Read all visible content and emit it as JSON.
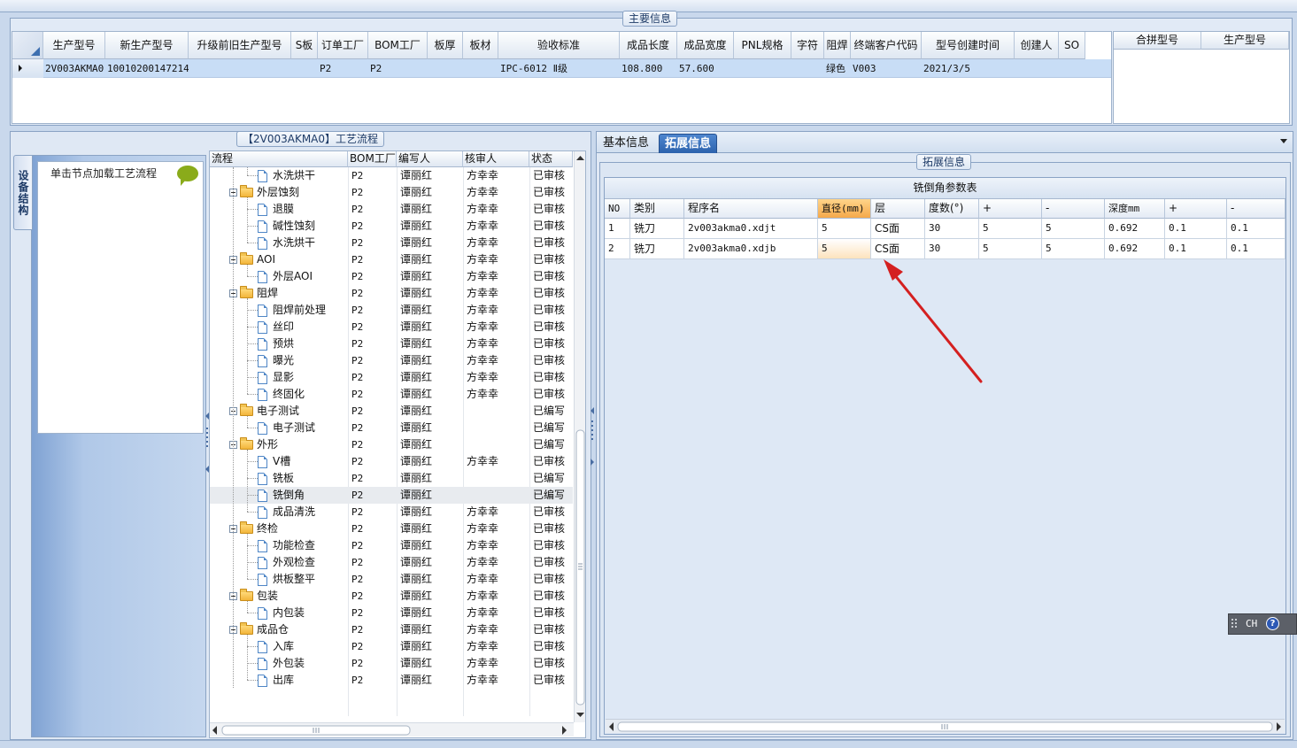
{
  "main_info": {
    "caption": "主要信息",
    "columns": [
      "生产型号",
      "新生产型号",
      "升级前旧生产型号",
      "S板",
      "订单工厂",
      "BOM工厂",
      "板厚",
      "板材",
      "验收标准",
      "成品长度",
      "成品宽度",
      "PNL规格",
      "字符",
      "阻焊",
      "终端客户代码",
      "型号创建时间",
      "创建人",
      "SO"
    ],
    "row": [
      "2V003AKMA0",
      "10010200147214",
      "",
      "",
      "P2",
      "P2",
      "",
      "",
      "IPC-6012 Ⅱ级",
      "108.800",
      "57.600",
      "",
      "",
      "绿色",
      "V003",
      "2021/3/5",
      "",
      ""
    ],
    "merge_columns": [
      "合拼型号",
      "生产型号"
    ]
  },
  "left_panel": {
    "vertical_tab": "设备结构",
    "hint": "单击节点加载工艺流程",
    "process_caption": "【2V003AKMA0】工艺流程",
    "tree_columns": [
      "流程",
      "BOM工厂",
      "编写人",
      "核审人",
      "状态"
    ],
    "rows": [
      {
        "level": 2,
        "name": "水洗烘干",
        "bom": "P2",
        "writer": "谭丽红",
        "reviewer": "方幸幸",
        "status": "已审核"
      },
      {
        "level": 1,
        "name": "外层蚀刻",
        "bom": "P2",
        "writer": "谭丽红",
        "reviewer": "方幸幸",
        "status": "已审核"
      },
      {
        "level": 2,
        "name": "退膜",
        "bom": "P2",
        "writer": "谭丽红",
        "reviewer": "方幸幸",
        "status": "已审核"
      },
      {
        "level": 2,
        "name": "碱性蚀刻",
        "bom": "P2",
        "writer": "谭丽红",
        "reviewer": "方幸幸",
        "status": "已审核"
      },
      {
        "level": 2,
        "name": "水洗烘干",
        "bom": "P2",
        "writer": "谭丽红",
        "reviewer": "方幸幸",
        "status": "已审核"
      },
      {
        "level": 1,
        "name": "AOI",
        "bom": "P2",
        "writer": "谭丽红",
        "reviewer": "方幸幸",
        "status": "已审核"
      },
      {
        "level": 2,
        "name": "外层AOI",
        "bom": "P2",
        "writer": "谭丽红",
        "reviewer": "方幸幸",
        "status": "已审核"
      },
      {
        "level": 1,
        "name": "阻焊",
        "bom": "P2",
        "writer": "谭丽红",
        "reviewer": "方幸幸",
        "status": "已审核"
      },
      {
        "level": 2,
        "name": "阻焊前处理",
        "bom": "P2",
        "writer": "谭丽红",
        "reviewer": "方幸幸",
        "status": "已审核"
      },
      {
        "level": 2,
        "name": "丝印",
        "bom": "P2",
        "writer": "谭丽红",
        "reviewer": "方幸幸",
        "status": "已审核"
      },
      {
        "level": 2,
        "name": "预烘",
        "bom": "P2",
        "writer": "谭丽红",
        "reviewer": "方幸幸",
        "status": "已审核"
      },
      {
        "level": 2,
        "name": "曝光",
        "bom": "P2",
        "writer": "谭丽红",
        "reviewer": "方幸幸",
        "status": "已审核"
      },
      {
        "level": 2,
        "name": "显影",
        "bom": "P2",
        "writer": "谭丽红",
        "reviewer": "方幸幸",
        "status": "已审核"
      },
      {
        "level": 2,
        "name": "终固化",
        "bom": "P2",
        "writer": "谭丽红",
        "reviewer": "方幸幸",
        "status": "已审核"
      },
      {
        "level": 1,
        "name": "电子测试",
        "bom": "P2",
        "writer": "谭丽红",
        "reviewer": "",
        "status": "已编写"
      },
      {
        "level": 2,
        "name": "电子测试",
        "bom": "P2",
        "writer": "谭丽红",
        "reviewer": "",
        "status": "已编写"
      },
      {
        "level": 1,
        "name": "外形",
        "bom": "P2",
        "writer": "谭丽红",
        "reviewer": "",
        "status": "已编写"
      },
      {
        "level": 2,
        "name": "V槽",
        "bom": "P2",
        "writer": "谭丽红",
        "reviewer": "方幸幸",
        "status": "已审核"
      },
      {
        "level": 2,
        "name": "铣板",
        "bom": "P2",
        "writer": "谭丽红",
        "reviewer": "",
        "status": "已编写"
      },
      {
        "level": 2,
        "name": "铣倒角",
        "bom": "P2",
        "writer": "谭丽红",
        "reviewer": "",
        "status": "已编写",
        "selected": true
      },
      {
        "level": 2,
        "name": "成品清洗",
        "bom": "P2",
        "writer": "谭丽红",
        "reviewer": "方幸幸",
        "status": "已审核"
      },
      {
        "level": 1,
        "name": "终检",
        "bom": "P2",
        "writer": "谭丽红",
        "reviewer": "方幸幸",
        "status": "已审核"
      },
      {
        "level": 2,
        "name": "功能检查",
        "bom": "P2",
        "writer": "谭丽红",
        "reviewer": "方幸幸",
        "status": "已审核"
      },
      {
        "level": 2,
        "name": "外观检查",
        "bom": "P2",
        "writer": "谭丽红",
        "reviewer": "方幸幸",
        "status": "已审核"
      },
      {
        "level": 2,
        "name": "烘板整平",
        "bom": "P2",
        "writer": "谭丽红",
        "reviewer": "方幸幸",
        "status": "已审核"
      },
      {
        "level": 1,
        "name": "包装",
        "bom": "P2",
        "writer": "谭丽红",
        "reviewer": "方幸幸",
        "status": "已审核"
      },
      {
        "level": 2,
        "name": "内包装",
        "bom": "P2",
        "writer": "谭丽红",
        "reviewer": "方幸幸",
        "status": "已审核"
      },
      {
        "level": 1,
        "name": "成品仓",
        "bom": "P2",
        "writer": "谭丽红",
        "reviewer": "方幸幸",
        "status": "已审核"
      },
      {
        "level": 2,
        "name": "入库",
        "bom": "P2",
        "writer": "谭丽红",
        "reviewer": "方幸幸",
        "status": "已审核"
      },
      {
        "level": 2,
        "name": "外包装",
        "bom": "P2",
        "writer": "谭丽红",
        "reviewer": "方幸幸",
        "status": "已审核"
      },
      {
        "level": 2,
        "name": "出库",
        "bom": "P2",
        "writer": "谭丽红",
        "reviewer": "方幸幸",
        "status": "已审核"
      }
    ]
  },
  "right_panel": {
    "tabs": [
      "基本信息",
      "拓展信息"
    ],
    "active_tab": "拓展信息",
    "ext_caption": "拓展信息",
    "table_title": "铣倒角参数表",
    "columns": [
      "NO",
      "类别",
      "程序名",
      "直径(mm)",
      "层",
      "度数(°)",
      "+",
      "-",
      "深度mm",
      "+",
      "-"
    ],
    "rows": [
      [
        "1",
        "铣刀",
        "2v003akma0.xdjt",
        "5",
        "CS面",
        "30",
        "5",
        "5",
        "0.692",
        "0.1",
        "0.1"
      ],
      [
        "2",
        "铣刀",
        "2v003akma0.xdjb",
        "5",
        "CS面",
        "30",
        "5",
        "5",
        "0.692",
        "0.1",
        "0.1"
      ]
    ],
    "highlight_color": "#f5a94a",
    "annotation_color": "#d42020"
  },
  "lang_bar": {
    "code": "CH",
    "help": "?"
  }
}
